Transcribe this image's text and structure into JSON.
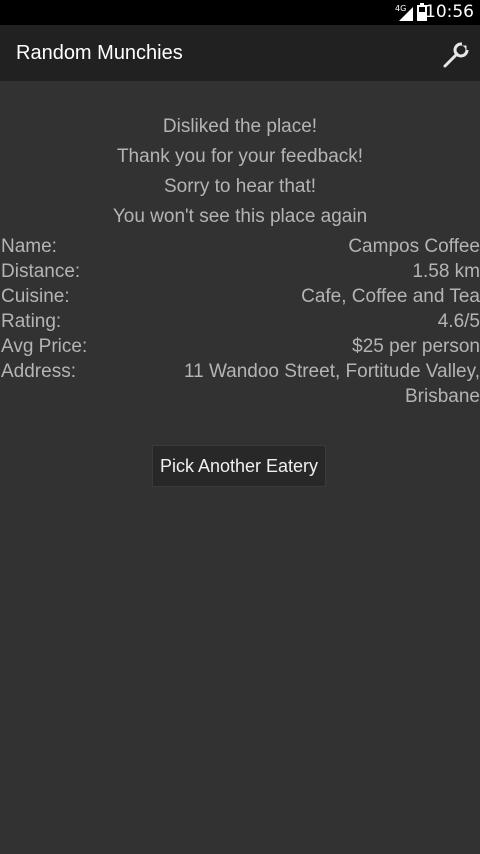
{
  "status_bar": {
    "network_label": "4G",
    "time": "10:56",
    "network_icon": "signal-icon",
    "battery_icon": "battery-icon"
  },
  "action_bar": {
    "title": "Random Munchies",
    "settings_icon": "wrench-icon"
  },
  "messages": [
    "Disliked the place!",
    "Thank you for your feedback!",
    "Sorry to hear that!",
    "You won't see this place again"
  ],
  "details": [
    {
      "label": "Name:",
      "value": "Campos Coffee"
    },
    {
      "label": "Distance:",
      "value": "1.58 km"
    },
    {
      "label": "Cuisine:",
      "value": "Cafe, Coffee and Tea"
    },
    {
      "label": "Rating:",
      "value": "4.6/5"
    },
    {
      "label": "Avg Price:",
      "value": "$25 per person"
    },
    {
      "label": "Address:",
      "value_line1": "11 Wandoo Street, Fortitude Valley,",
      "value_line2": "Brisbane"
    }
  ],
  "button": {
    "label": "Pick Another Eatery"
  },
  "colors": {
    "background": "#323232",
    "action_bar": "#212121",
    "text_secondary": "#b4b4b4"
  }
}
